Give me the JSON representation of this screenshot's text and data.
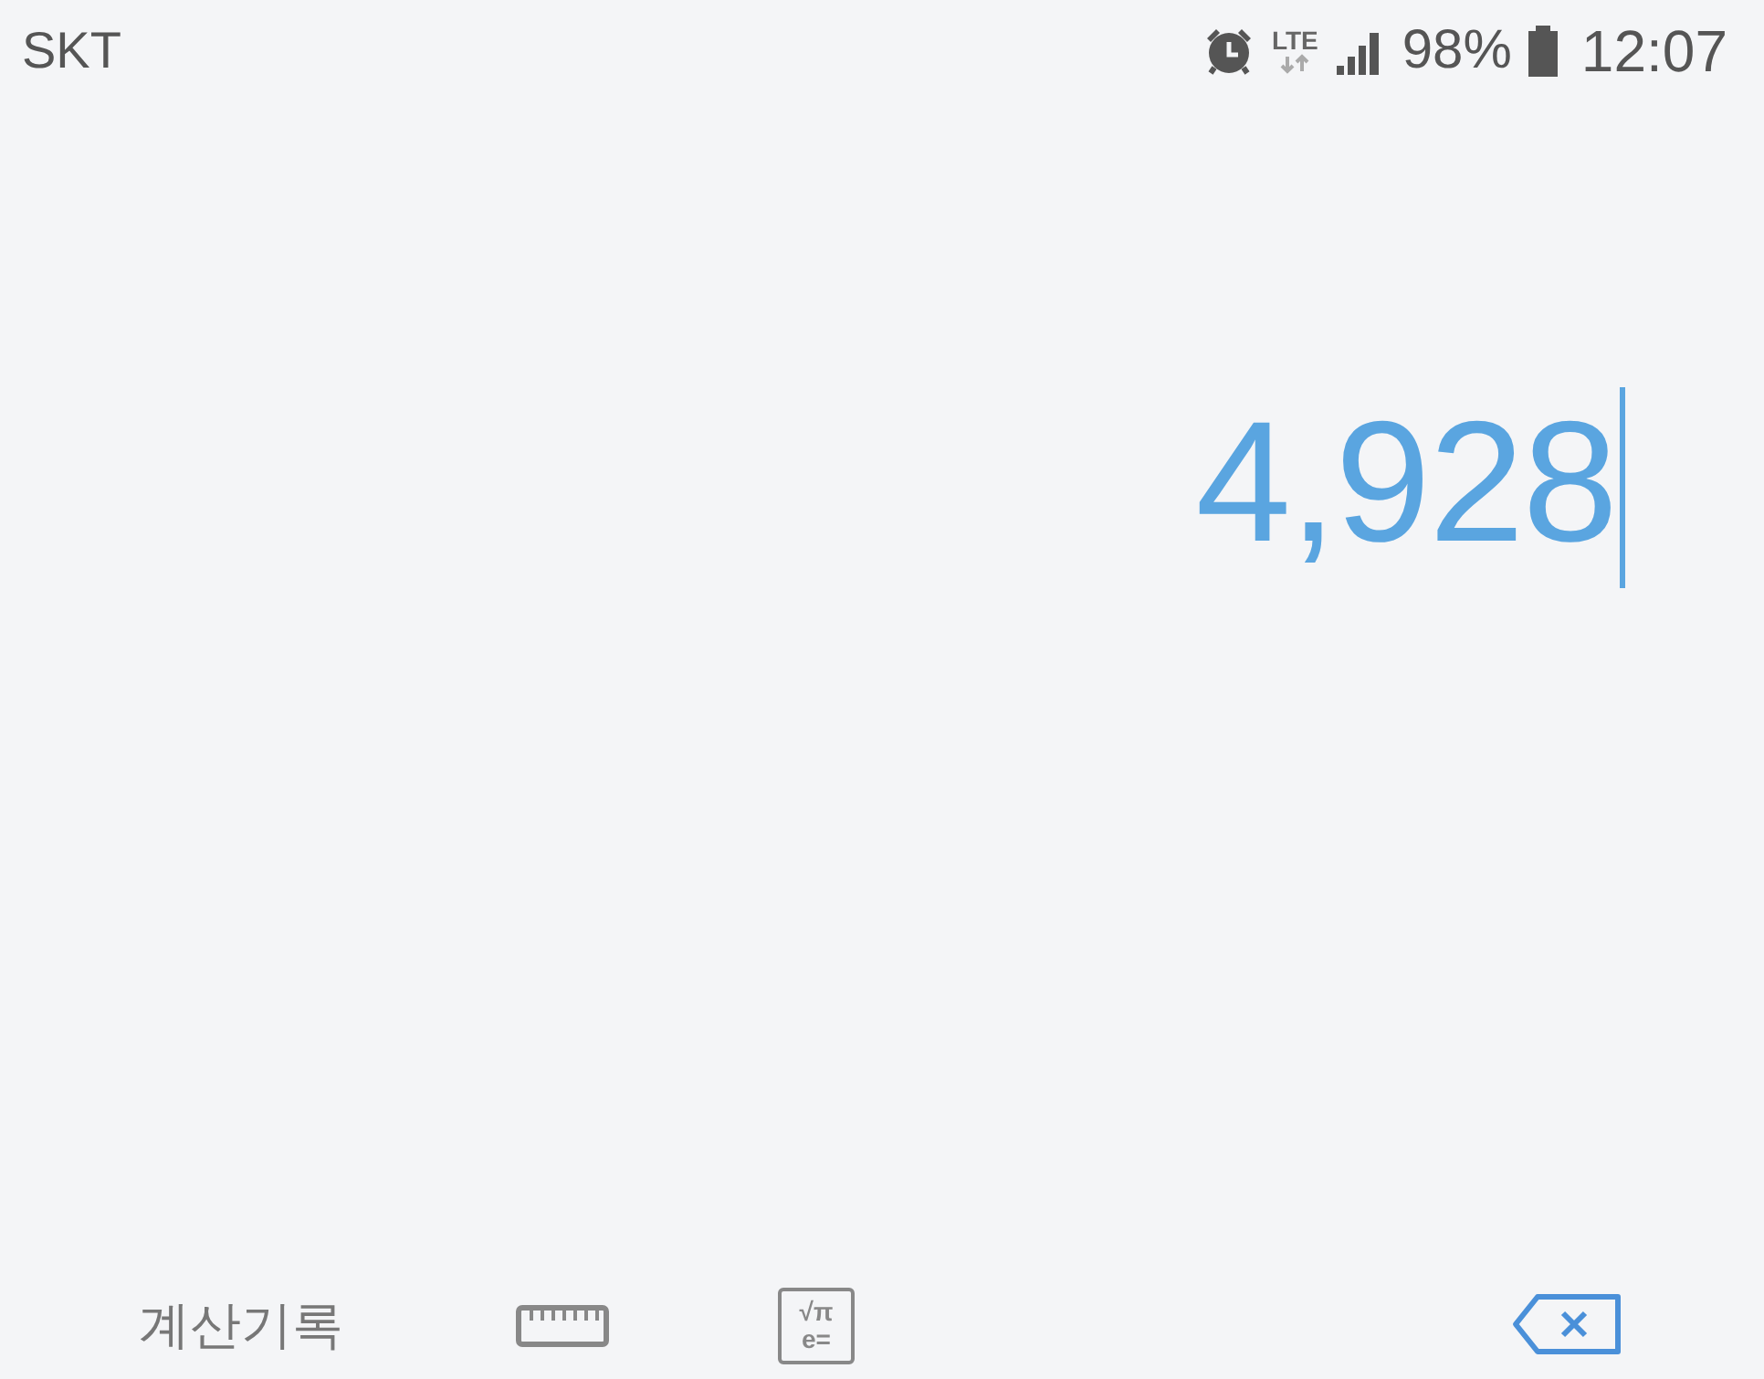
{
  "status_bar": {
    "carrier": "SKT",
    "network": "LTE",
    "battery": "98%",
    "time": "12:07"
  },
  "display": {
    "value": "4,928",
    "cursor": true
  },
  "toolbar": {
    "history_label": "계산기록",
    "scientific_top": "√π",
    "scientific_bottom": "e="
  }
}
